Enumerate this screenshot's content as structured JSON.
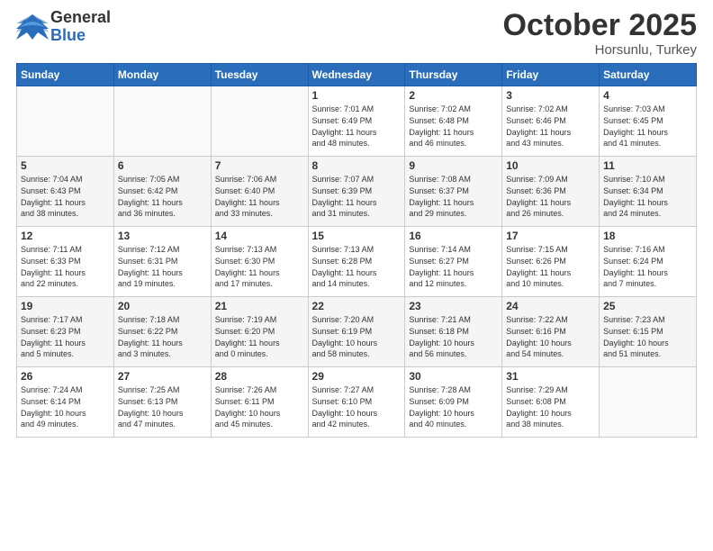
{
  "logo": {
    "general": "General",
    "blue": "Blue"
  },
  "header": {
    "month": "October 2025",
    "location": "Horsunlu, Turkey"
  },
  "days_of_week": [
    "Sunday",
    "Monday",
    "Tuesday",
    "Wednesday",
    "Thursday",
    "Friday",
    "Saturday"
  ],
  "weeks": [
    [
      {
        "day": "",
        "info": ""
      },
      {
        "day": "",
        "info": ""
      },
      {
        "day": "",
        "info": ""
      },
      {
        "day": "1",
        "info": "Sunrise: 7:01 AM\nSunset: 6:49 PM\nDaylight: 11 hours\nand 48 minutes."
      },
      {
        "day": "2",
        "info": "Sunrise: 7:02 AM\nSunset: 6:48 PM\nDaylight: 11 hours\nand 46 minutes."
      },
      {
        "day": "3",
        "info": "Sunrise: 7:02 AM\nSunset: 6:46 PM\nDaylight: 11 hours\nand 43 minutes."
      },
      {
        "day": "4",
        "info": "Sunrise: 7:03 AM\nSunset: 6:45 PM\nDaylight: 11 hours\nand 41 minutes."
      }
    ],
    [
      {
        "day": "5",
        "info": "Sunrise: 7:04 AM\nSunset: 6:43 PM\nDaylight: 11 hours\nand 38 minutes."
      },
      {
        "day": "6",
        "info": "Sunrise: 7:05 AM\nSunset: 6:42 PM\nDaylight: 11 hours\nand 36 minutes."
      },
      {
        "day": "7",
        "info": "Sunrise: 7:06 AM\nSunset: 6:40 PM\nDaylight: 11 hours\nand 33 minutes."
      },
      {
        "day": "8",
        "info": "Sunrise: 7:07 AM\nSunset: 6:39 PM\nDaylight: 11 hours\nand 31 minutes."
      },
      {
        "day": "9",
        "info": "Sunrise: 7:08 AM\nSunset: 6:37 PM\nDaylight: 11 hours\nand 29 minutes."
      },
      {
        "day": "10",
        "info": "Sunrise: 7:09 AM\nSunset: 6:36 PM\nDaylight: 11 hours\nand 26 minutes."
      },
      {
        "day": "11",
        "info": "Sunrise: 7:10 AM\nSunset: 6:34 PM\nDaylight: 11 hours\nand 24 minutes."
      }
    ],
    [
      {
        "day": "12",
        "info": "Sunrise: 7:11 AM\nSunset: 6:33 PM\nDaylight: 11 hours\nand 22 minutes."
      },
      {
        "day": "13",
        "info": "Sunrise: 7:12 AM\nSunset: 6:31 PM\nDaylight: 11 hours\nand 19 minutes."
      },
      {
        "day": "14",
        "info": "Sunrise: 7:13 AM\nSunset: 6:30 PM\nDaylight: 11 hours\nand 17 minutes."
      },
      {
        "day": "15",
        "info": "Sunrise: 7:13 AM\nSunset: 6:28 PM\nDaylight: 11 hours\nand 14 minutes."
      },
      {
        "day": "16",
        "info": "Sunrise: 7:14 AM\nSunset: 6:27 PM\nDaylight: 11 hours\nand 12 minutes."
      },
      {
        "day": "17",
        "info": "Sunrise: 7:15 AM\nSunset: 6:26 PM\nDaylight: 11 hours\nand 10 minutes."
      },
      {
        "day": "18",
        "info": "Sunrise: 7:16 AM\nSunset: 6:24 PM\nDaylight: 11 hours\nand 7 minutes."
      }
    ],
    [
      {
        "day": "19",
        "info": "Sunrise: 7:17 AM\nSunset: 6:23 PM\nDaylight: 11 hours\nand 5 minutes."
      },
      {
        "day": "20",
        "info": "Sunrise: 7:18 AM\nSunset: 6:22 PM\nDaylight: 11 hours\nand 3 minutes."
      },
      {
        "day": "21",
        "info": "Sunrise: 7:19 AM\nSunset: 6:20 PM\nDaylight: 11 hours\nand 0 minutes."
      },
      {
        "day": "22",
        "info": "Sunrise: 7:20 AM\nSunset: 6:19 PM\nDaylight: 10 hours\nand 58 minutes."
      },
      {
        "day": "23",
        "info": "Sunrise: 7:21 AM\nSunset: 6:18 PM\nDaylight: 10 hours\nand 56 minutes."
      },
      {
        "day": "24",
        "info": "Sunrise: 7:22 AM\nSunset: 6:16 PM\nDaylight: 10 hours\nand 54 minutes."
      },
      {
        "day": "25",
        "info": "Sunrise: 7:23 AM\nSunset: 6:15 PM\nDaylight: 10 hours\nand 51 minutes."
      }
    ],
    [
      {
        "day": "26",
        "info": "Sunrise: 7:24 AM\nSunset: 6:14 PM\nDaylight: 10 hours\nand 49 minutes."
      },
      {
        "day": "27",
        "info": "Sunrise: 7:25 AM\nSunset: 6:13 PM\nDaylight: 10 hours\nand 47 minutes."
      },
      {
        "day": "28",
        "info": "Sunrise: 7:26 AM\nSunset: 6:11 PM\nDaylight: 10 hours\nand 45 minutes."
      },
      {
        "day": "29",
        "info": "Sunrise: 7:27 AM\nSunset: 6:10 PM\nDaylight: 10 hours\nand 42 minutes."
      },
      {
        "day": "30",
        "info": "Sunrise: 7:28 AM\nSunset: 6:09 PM\nDaylight: 10 hours\nand 40 minutes."
      },
      {
        "day": "31",
        "info": "Sunrise: 7:29 AM\nSunset: 6:08 PM\nDaylight: 10 hours\nand 38 minutes."
      },
      {
        "day": "",
        "info": ""
      }
    ]
  ]
}
